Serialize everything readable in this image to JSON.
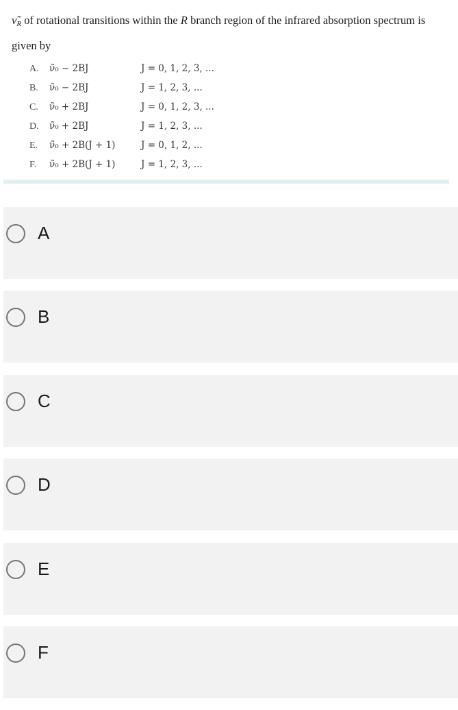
{
  "question": {
    "symbol_main": "ν̃",
    "symbol_sub": "R",
    "text_part1": " of rotational transitions within the ",
    "text_italic": "R",
    "text_part2": " branch region of the infrared absorption spectrum is",
    "text_line2": "given by"
  },
  "choices": [
    {
      "letter": "A.",
      "expr": "ν̃₀ − 2BJ",
      "range": "J = 0, 1,  2,  3,  ..."
    },
    {
      "letter": "B.",
      "expr": "ν̃₀ − 2BJ",
      "range": "J = 1,  2,  3,  ..."
    },
    {
      "letter": "C.",
      "expr": "ν̃₀ + 2BJ",
      "range": "J = 0, 1,  2,  3,  ..."
    },
    {
      "letter": "D.",
      "expr": "ν̃₀ + 2BJ",
      "range": "J = 1,  2,  3,  ..."
    },
    {
      "letter": "E.",
      "expr": "ν̃₀ + 2B(J + 1)",
      "range": "J = 0, 1,  2,  ..."
    },
    {
      "letter": "F.",
      "expr": "ν̃₀ + 2B(J + 1)",
      "range": "J = 1,  2,  3,  ..."
    }
  ],
  "options": [
    {
      "label": "A"
    },
    {
      "label": "B"
    },
    {
      "label": "C"
    },
    {
      "label": "D"
    },
    {
      "label": "E"
    },
    {
      "label": "F"
    }
  ]
}
